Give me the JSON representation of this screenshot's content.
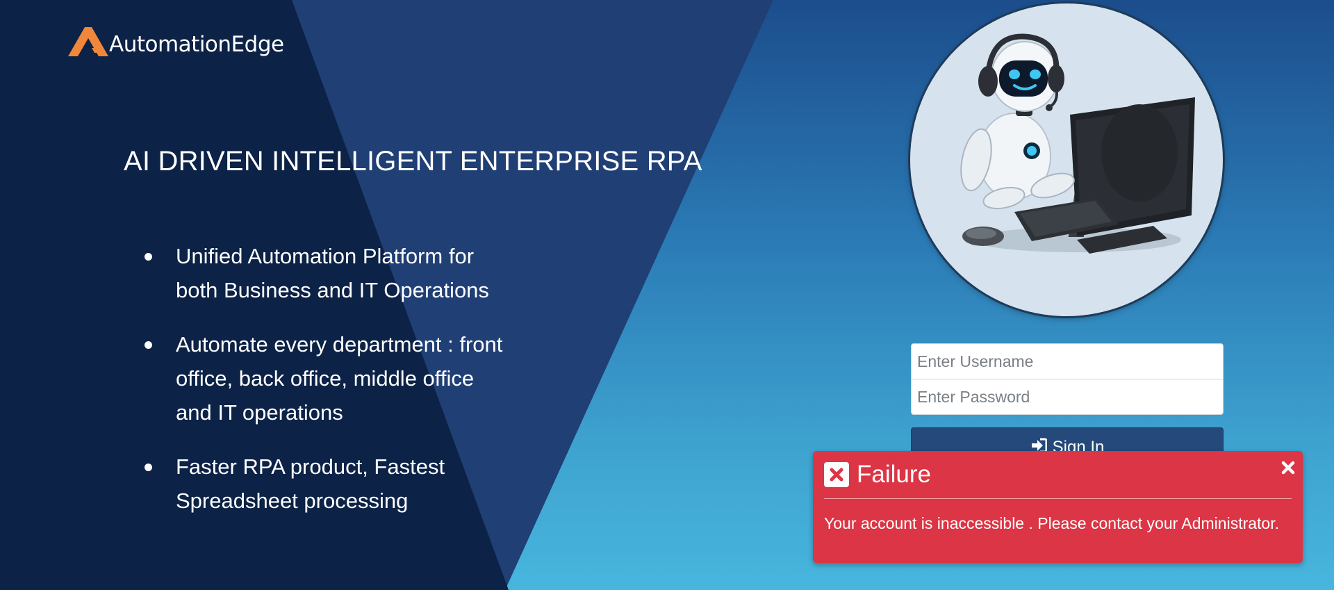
{
  "brand": {
    "logo_text": "AutomationEdge",
    "accent_color": "#f0873a"
  },
  "hero": {
    "headline": "AI DRIVEN INTELLIGENT ENTERPRISE RPA",
    "features": [
      "Unified Automation Platform for both Business and IT Operations",
      "Automate every department : front office, back office, middle office and IT operations",
      "Faster RPA product, Fastest Spreadsheet processing"
    ]
  },
  "login": {
    "username_placeholder": "Enter Username",
    "password_placeholder": "Enter Password",
    "username_value": "",
    "password_value": "",
    "signin_label": "Sign In",
    "signin_icon": "sign-in-icon",
    "button_color": "#24497a"
  },
  "toast": {
    "title": "Failure",
    "message": "Your account is inaccessible . Please contact your Administrator.",
    "icon": "close-square-icon",
    "close_icon": "close-icon",
    "color": "#dc3545"
  },
  "illustration": {
    "icon": "robot-at-computer-illustration"
  }
}
